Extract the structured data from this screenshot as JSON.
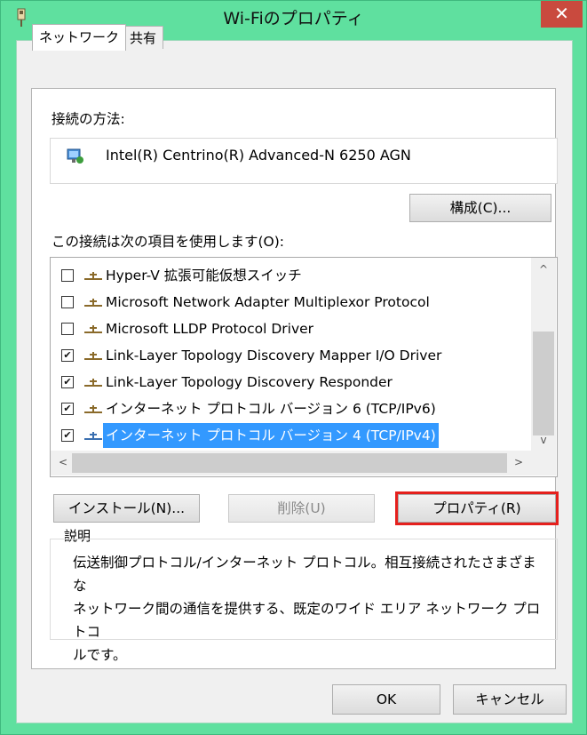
{
  "window": {
    "title": "Wi-Fiのプロパティ",
    "close_glyph": "✕",
    "accent": "#5fe09f"
  },
  "tabs": [
    {
      "label": "ネットワーク",
      "active": true
    },
    {
      "label": "共有",
      "active": false
    }
  ],
  "connection": {
    "label": "接続の方法:",
    "adapter": "Intel(R) Centrino(R) Advanced-N 6250 AGN",
    "configure_button": "構成(C)..."
  },
  "items": {
    "label": "この接続は次の項目を使用します(O):",
    "rows": [
      {
        "checked": false,
        "text": "Hyper-V 拡張可能仮想スイッチ",
        "selected": false
      },
      {
        "checked": false,
        "text": "Microsoft Network Adapter Multiplexor Protocol",
        "selected": false
      },
      {
        "checked": false,
        "text": "Microsoft LLDP Protocol Driver",
        "selected": false
      },
      {
        "checked": true,
        "text": "Link-Layer Topology Discovery Mapper I/O Driver",
        "selected": false
      },
      {
        "checked": true,
        "text": "Link-Layer Topology Discovery Responder",
        "selected": false
      },
      {
        "checked": true,
        "text": "インターネット プロトコル バージョン 6 (TCP/IPv6)",
        "selected": false
      },
      {
        "checked": true,
        "text": "インターネット プロトコル バージョン 4 (TCP/IPv4)",
        "selected": true
      }
    ],
    "check_glyph": "✔"
  },
  "actions": {
    "install": "インストール(N)...",
    "uninstall": "削除(U)",
    "properties": "プロパティ(R)"
  },
  "description": {
    "legend": "説明",
    "lines": [
      "伝送制御プロトコル/インターネット プロトコル。相互接続されたさまざまな",
      "ネットワーク間の通信を提供する、既定のワイド エリア ネットワーク プロトコ",
      "ルです。"
    ]
  },
  "footer": {
    "ok": "OK",
    "cancel": "キャンセル"
  },
  "scroll": {
    "up": "^",
    "down": "v",
    "left": "<",
    "right": ">"
  }
}
